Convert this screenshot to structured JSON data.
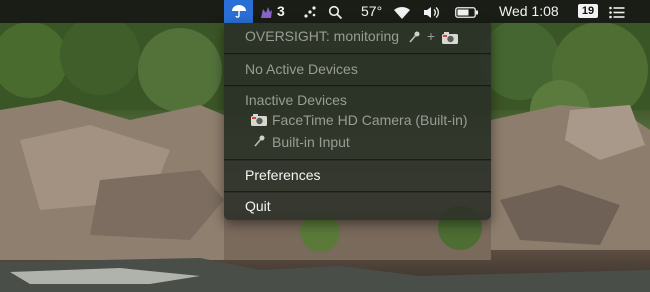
{
  "menubar": {
    "badge_count": "3",
    "temperature": "57°",
    "clock": "Wed 1:08",
    "date_badge": "19",
    "icons": {
      "app": "umbrella-icon",
      "status": "purple-creature-icon",
      "dots": "connection-dots-icon",
      "search": "search-icon",
      "wifi": "wifi-icon",
      "volume": "volume-icon",
      "battery": "battery-icon",
      "list": "list-icon"
    },
    "colors": {
      "highlight": "#2a6fd6",
      "bar_bg": "#161814"
    }
  },
  "menu": {
    "header": "OVERSIGHT: monitoring",
    "header_suffix": "+",
    "no_active": "No Active Devices",
    "inactive_heading": "Inactive Devices",
    "camera_device": "FaceTime HD Camera (Built-in)",
    "mic_device": "Built-in Input",
    "preferences": "Preferences",
    "quit": "Quit",
    "icons": {
      "mic": "microphone-icon",
      "camera": "camera-icon"
    }
  }
}
